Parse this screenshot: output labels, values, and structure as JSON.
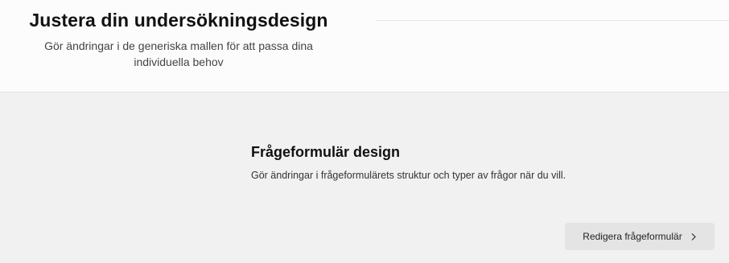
{
  "header": {
    "title": "Justera din undersökningsdesign",
    "subtitle_line1": "Gör ändringar i de generiska mallen för att passa dina",
    "subtitle_line2": "individuella behov"
  },
  "card": {
    "title": "Frågeformulär design",
    "description": "Gör ändringar i frågeformulärets struktur och typer av frågor när du vill.",
    "button_label": "Redigera frågeformulär",
    "button_icon": "chevron-right-icon"
  }
}
